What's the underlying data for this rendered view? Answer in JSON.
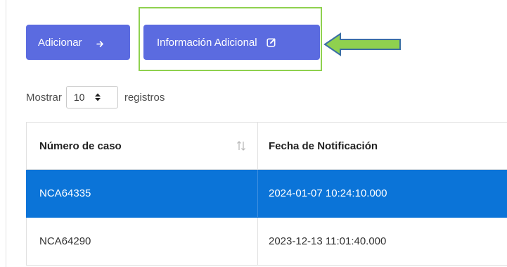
{
  "toolbar": {
    "add_label": "Adicionar",
    "info_label": "Información Adicional"
  },
  "length_menu": {
    "prefix": "Mostrar",
    "selected": "10",
    "suffix": "registros"
  },
  "table": {
    "columns": [
      "Número de caso",
      "Fecha de Notificación"
    ],
    "rows": [
      [
        "NCA64335",
        "2024-01-07 10:24:10.000"
      ],
      [
        "NCA64290",
        "2023-12-13 11:01:40.000"
      ]
    ],
    "selected_row": 0
  },
  "colors": {
    "button": "#5b6be0",
    "selected_row": "#0b74d8",
    "highlight": "#8fd14f"
  },
  "icons": [
    "arrow-right-icon",
    "edit-icon",
    "sort-icon",
    "green-arrow-icon"
  ]
}
